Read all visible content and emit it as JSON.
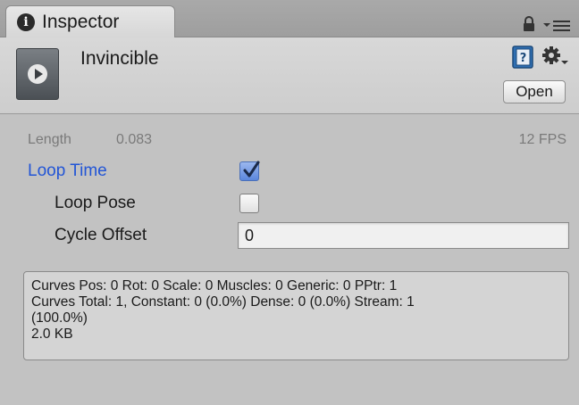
{
  "tab": {
    "label": "Inspector",
    "icon": "info-icon",
    "icon_glyph": "i"
  },
  "header": {
    "asset_name": "Invincible",
    "asset_icon": "animation-clip-icon",
    "open_label": "Open",
    "help_icon": "help-book-icon",
    "settings_icon": "gear-icon"
  },
  "toolbar": {
    "lock_icon": "lock-icon",
    "menu_icon": "menu-icon"
  },
  "clip": {
    "length_label": "Length",
    "length_value": "0.083",
    "fps_label": "12 FPS",
    "loop_time_label": "Loop Time",
    "loop_time_checked": true,
    "loop_pose_label": "Loop Pose",
    "loop_pose_checked": false,
    "cycle_offset_label": "Cycle Offset",
    "cycle_offset_value": "0"
  },
  "info": {
    "line1": "Curves Pos: 0 Rot: 0 Scale: 0 Muscles: 0 Generic: 0 PPtr: 1",
    "line2": "Curves Total: 1, Constant: 0 (0.0%) Dense: 0 (0.0%) Stream: 1",
    "line3": "(100.0%)",
    "line4": "2.0 KB"
  },
  "colors": {
    "accent_label": "#2255d6",
    "background": "#c2c2c2"
  }
}
